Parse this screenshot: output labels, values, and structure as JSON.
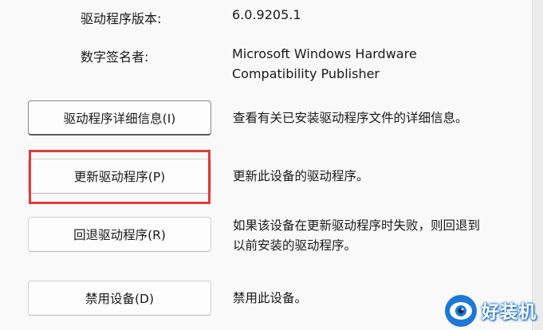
{
  "info": {
    "version_label": "驱动程序版本:",
    "version_value": "6.0.9205.1",
    "signer_label": "数字签名者:",
    "signer_line1": "Microsoft Windows Hardware",
    "signer_line2": "Compatibility Publisher"
  },
  "actions": [
    {
      "label": "驱动程序详细信息(I)",
      "description": "查看有关已安装驱动程序文件的详细信息。"
    },
    {
      "label": "更新驱动程序(P)",
      "description": "更新此设备的驱动程序。"
    },
    {
      "label": "回退驱动程序(R)",
      "description_line1": "如果该设备在更新驱动程序时失败，则回退到",
      "description_line2": "以前安装的驱动程序。"
    },
    {
      "label": "禁用设备(D)",
      "description": "禁用此设备。"
    }
  ],
  "watermark": {
    "text": "好装机",
    "icon": "eye-logo-icon"
  },
  "colors": {
    "highlight": "#e03a3a",
    "watermark_blue": "#1e78d6"
  }
}
